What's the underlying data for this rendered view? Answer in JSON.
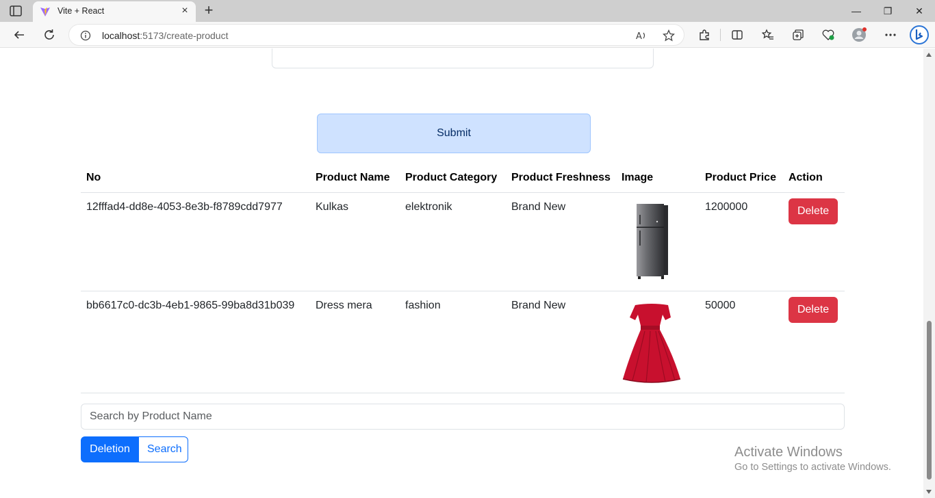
{
  "browser": {
    "tab_title": "Vite + React",
    "tab_close": "×",
    "newtab": "+",
    "url_host": "localhost",
    "url_path": ":5173/create-product",
    "window_min": "—",
    "window_max": "❐",
    "window_close": "✕"
  },
  "form": {
    "submit_label": "Submit"
  },
  "table": {
    "headers": {
      "no": "No",
      "name": "Product Name",
      "category": "Product Category",
      "freshness": "Product Freshness",
      "image": "Image",
      "price": "Product Price",
      "action": "Action"
    },
    "rows": [
      {
        "no": "12fffad4-dd8e-4053-8e3b-f8789cdd7977",
        "name": "Kulkas",
        "category": "elektronik",
        "freshness": "Brand New",
        "image_icon": "refrigerator-image",
        "price": "1200000",
        "action": "Delete"
      },
      {
        "no": "bb6617c0-dc3b-4eb1-9865-99ba8d31b039",
        "name": "Dress mera",
        "category": "fashion",
        "freshness": "Brand New",
        "image_icon": "red-dress-image",
        "price": "50000",
        "action": "Delete"
      }
    ]
  },
  "search": {
    "placeholder": "Search by Product Name",
    "value": ""
  },
  "buttons": {
    "deletion": "Deletion",
    "search": "Search"
  },
  "watermark": {
    "line1": "Activate Windows",
    "line2": "Go to Settings to activate Windows."
  },
  "colors": {
    "primary": "#0d6efd",
    "danger": "#dc3545",
    "submit_bg": "#cfe2ff"
  }
}
